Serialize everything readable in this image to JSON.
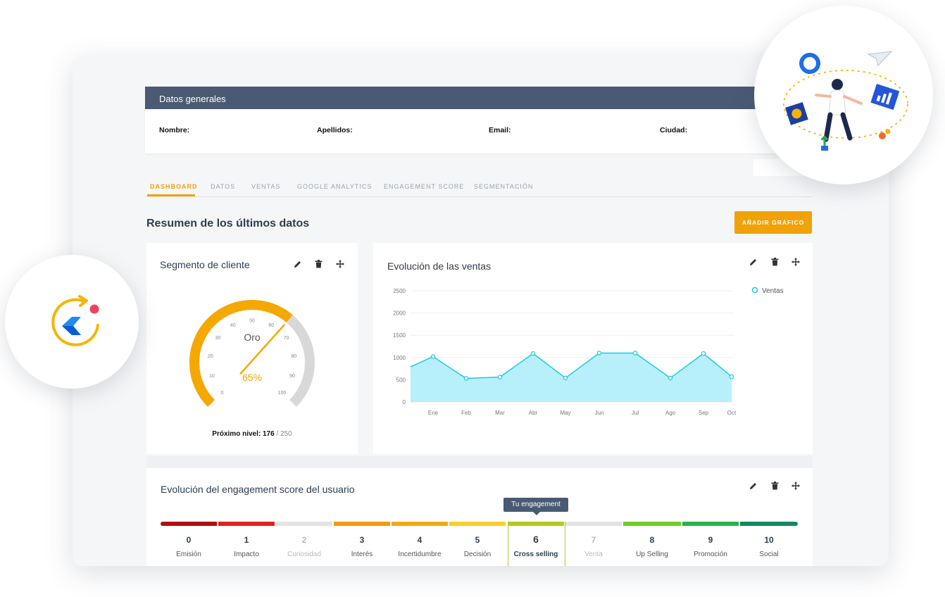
{
  "general": {
    "title": "Datos generales",
    "fields": [
      "Nombre:",
      "Apellidos:",
      "Email:",
      "Ciudad:"
    ]
  },
  "tabs": [
    "DASHBOARD",
    "DATOS",
    "VENTAS",
    "GOOGLE ANALYTICS",
    "ENGAGEMENT SCORE",
    "SEGMENTACIÓN"
  ],
  "section_title": "Resumen de los últimos datos",
  "add_button": "AÑADIR GRÁFICO",
  "segment": {
    "title": "Segmento de cliente",
    "label": "Oro",
    "percent_text": "65%",
    "value": 65,
    "ticks": [
      "0",
      "10",
      "20",
      "30",
      "40",
      "50",
      "60",
      "70",
      "80",
      "90",
      "100"
    ],
    "next_label": "Próximo nivel:",
    "next_value": "176",
    "next_total": "/ 250",
    "color_fill": "#f5a800",
    "color_track": "#d8d8d8"
  },
  "sales": {
    "title": "Evolución de las ventas",
    "legend": "Ventas",
    "color": "#1dc9e6"
  },
  "chart_data": {
    "type": "area",
    "title": "Evolución de las ventas",
    "categories": [
      "Ene",
      "Feb",
      "Mar",
      "Abr",
      "May",
      "Jun",
      "Jul",
      "Ago",
      "Sep",
      "Oct"
    ],
    "series": [
      {
        "name": "Ventas",
        "values": [
          1020,
          530,
          560,
          1090,
          540,
          1100,
          1100,
          540,
          1090,
          570
        ],
        "start_value": 790
      }
    ],
    "y_ticks": [
      "0",
      "500",
      "1000",
      "1500",
      "2000",
      "2500"
    ],
    "ylim": [
      0,
      2500
    ],
    "grid": true,
    "legend": "top-right"
  },
  "engagement": {
    "title": "Evolución del engagement score del usuario",
    "tooltip": "Tu engagement",
    "current": 6,
    "stages": [
      {
        "num": "0",
        "label": "Emisión",
        "color": "#b10f0f",
        "dim": false
      },
      {
        "num": "1",
        "label": "Impacto",
        "color": "#e0241b",
        "dim": false
      },
      {
        "num": "2",
        "label": "Curiosidad",
        "color": "#e3e3e3",
        "dim": true
      },
      {
        "num": "3",
        "label": "Interés",
        "color": "#f39a12",
        "dim": false
      },
      {
        "num": "4",
        "label": "Incertidumbre",
        "color": "#f5a90f",
        "dim": false
      },
      {
        "num": "5",
        "label": "Decisión",
        "color": "#f8cf2a",
        "dim": false
      },
      {
        "num": "6",
        "label": "Cross selling",
        "color": "#b7c91d",
        "dim": false
      },
      {
        "num": "7",
        "label": "Venta",
        "color": "#e3e3e3",
        "dim": true
      },
      {
        "num": "8",
        "label": "Up Selling",
        "color": "#6fce2a",
        "dim": false
      },
      {
        "num": "9",
        "label": "Promoción",
        "color": "#2bb34a",
        "dim": false
      },
      {
        "num": "10",
        "label": "Social",
        "color": "#128a5f",
        "dim": false
      }
    ]
  },
  "icons": {
    "edit": "pencil-icon",
    "delete": "trash-icon",
    "move": "move-icon",
    "logo": "brand-logo",
    "illustration": "analytics-illustration"
  }
}
